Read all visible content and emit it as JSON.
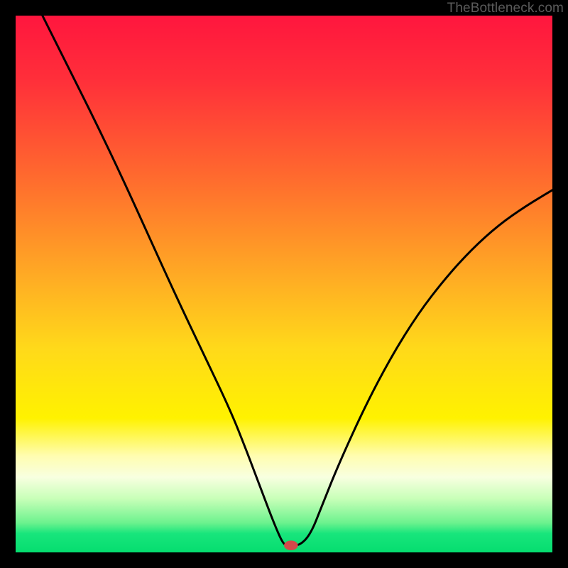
{
  "watermark": "TheBottleneck.com",
  "chart_data": {
    "type": "line",
    "title": "",
    "xlabel": "",
    "ylabel": "",
    "xlim": [
      0,
      100
    ],
    "ylim": [
      0,
      100
    ],
    "grid": false,
    "gradient_stops": [
      {
        "offset": 0,
        "color": "#ff163e"
      },
      {
        "offset": 0.12,
        "color": "#ff2f3a"
      },
      {
        "offset": 0.3,
        "color": "#ff6a2e"
      },
      {
        "offset": 0.5,
        "color": "#ffb023"
      },
      {
        "offset": 0.62,
        "color": "#ffd91a"
      },
      {
        "offset": 0.75,
        "color": "#fff200"
      },
      {
        "offset": 0.82,
        "color": "#fffdb0"
      },
      {
        "offset": 0.86,
        "color": "#f8ffe0"
      },
      {
        "offset": 0.9,
        "color": "#c8ffb8"
      },
      {
        "offset": 0.945,
        "color": "#6cf28e"
      },
      {
        "offset": 0.965,
        "color": "#18e57c"
      },
      {
        "offset": 1.0,
        "color": "#05dd6f"
      }
    ],
    "curve": {
      "x": [
        5.0,
        10.0,
        15.0,
        20.0,
        25.0,
        30.0,
        35.0,
        40.0,
        43.0,
        46.0,
        48.5,
        50.0,
        51.0,
        53.0,
        55.0,
        57.0,
        60.0,
        65.0,
        70.0,
        75.0,
        80.0,
        85.0,
        90.0,
        95.0,
        100.0
      ],
      "y": [
        100.0,
        90.0,
        80.0,
        69.5,
        58.5,
        47.5,
        37.0,
        26.5,
        19.0,
        11.0,
        4.5,
        1.3,
        1.3,
        1.3,
        3.5,
        8.5,
        16.0,
        27.0,
        36.5,
        44.5,
        51.0,
        56.5,
        61.0,
        64.5,
        67.5
      ]
    },
    "marker": {
      "x": 51.3,
      "y": 1.3,
      "rx": 1.3,
      "ry": 0.9,
      "fill": "#d24a4a"
    }
  }
}
